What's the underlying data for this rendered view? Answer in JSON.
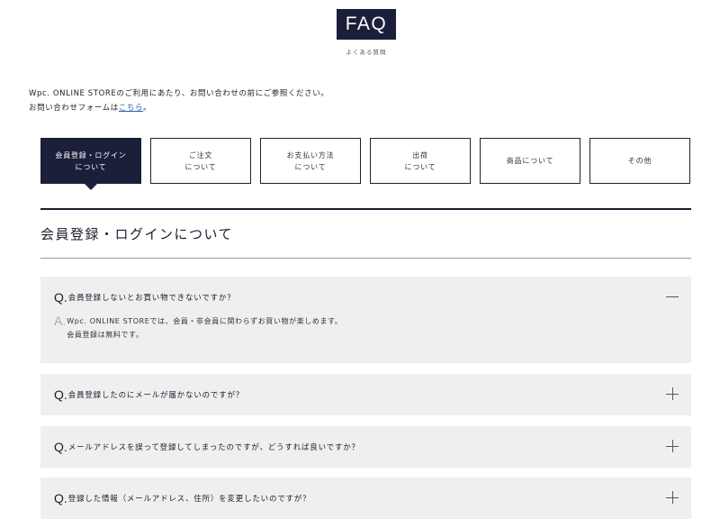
{
  "header": {
    "logo_text": "FAQ",
    "subtitle": "よくある質問"
  },
  "intro": {
    "line1": "Wpc. ONLINE STOREのご利用にあたり、お問い合わせの前にご参照ください。",
    "line2_prefix": "お問い合わせフォームは",
    "line2_link": "こちら",
    "line2_suffix": "。"
  },
  "tabs": [
    {
      "line1": "会員登録・ログイン",
      "line2": "について",
      "active": true
    },
    {
      "line1": "ご注文",
      "line2": "について",
      "active": false
    },
    {
      "line1": "お支払い方法",
      "line2": "について",
      "active": false
    },
    {
      "line1": "出荷",
      "line2": "について",
      "active": false
    },
    {
      "line1": "商品について",
      "line2": "",
      "active": false
    },
    {
      "line1": "その他",
      "line2": "",
      "active": false
    }
  ],
  "section": {
    "title": "会員登録・ログインについて"
  },
  "faq": [
    {
      "q_mark": "Q.",
      "question": "会員登録しないとお買い物できないですか？",
      "expanded": true,
      "a_mark": "A.",
      "answer_line1": "Wpc. ONLINE STOREでは、会員・非会員に関わらずお買い物が楽しめます。",
      "answer_line2": "会員登録は無料です。"
    },
    {
      "q_mark": "Q.",
      "question": "会員登録したのにメールが届かないのですが？",
      "expanded": false
    },
    {
      "q_mark": "Q.",
      "question": "メールアドレスを誤って登録してしまったのですが、どうすれば良いですか？",
      "expanded": false
    },
    {
      "q_mark": "Q.",
      "question": "登録した情報（メールアドレス、住所）を変更したいのですが？",
      "expanded": false
    }
  ],
  "colors": {
    "navy": "#1c1f3a",
    "item_bg": "#efefef",
    "link": "#2a5db0"
  },
  "icons": {
    "expanded": "minus-icon",
    "collapsed": "plus-icon"
  }
}
